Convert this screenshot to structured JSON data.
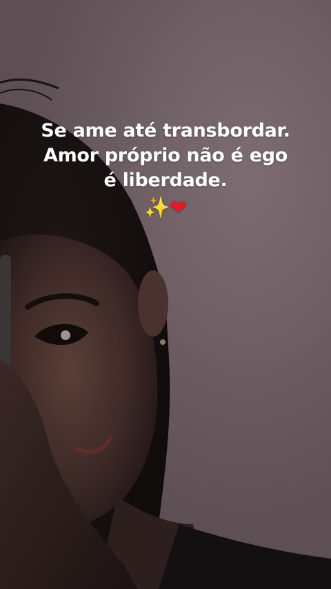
{
  "caption": {
    "line1": "Se ame até transbordar.",
    "line2": "Amor próprio não é ego",
    "line3": "é liberdade.",
    "sparkles": "✨",
    "heart": "❤"
  },
  "colors": {
    "wall": "#6f6065",
    "text": "#ffffff",
    "heart": "#e01b2b",
    "sparkles": "#ffd84a"
  }
}
